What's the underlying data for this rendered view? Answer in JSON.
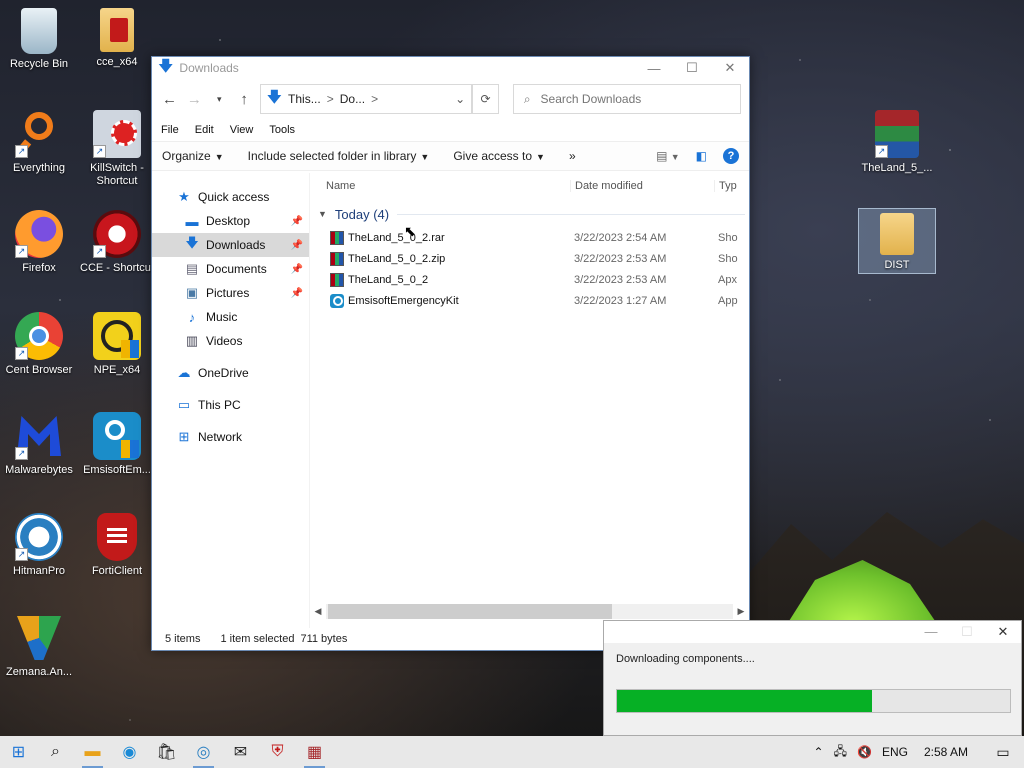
{
  "desktop": {
    "icons_left": [
      {
        "label": "Recycle Bin",
        "icon": "recycle-bin-icon"
      },
      {
        "label": "Everything",
        "icon": "everything-search-icon"
      },
      {
        "label": "Firefox",
        "icon": "firefox-icon"
      },
      {
        "label": "Cent Browser",
        "icon": "cent-browser-icon"
      },
      {
        "label": "Malwarebytes",
        "icon": "malwarebytes-icon"
      },
      {
        "label": "HitmanPro",
        "icon": "hitmanpro-icon"
      },
      {
        "label": "Zemana.An...",
        "icon": "zemana-icon"
      }
    ],
    "icons_col2": [
      {
        "label": "cce_x64",
        "icon": "cce-folder-icon"
      },
      {
        "label": "KillSwitch - Shortcut",
        "icon": "killswitch-icon"
      },
      {
        "label": "CCE - Shortcut",
        "icon": "cce-icon"
      },
      {
        "label": "NPE_x64",
        "icon": "npe-icon"
      },
      {
        "label": "EmsisoftEm...",
        "icon": "emsisoft-icon"
      },
      {
        "label": "FortiClient",
        "icon": "forticlient-icon"
      }
    ],
    "icons_right": [
      {
        "label": "TheLand_5_...",
        "icon": "winrar-archive-icon"
      },
      {
        "label": "DIST",
        "icon": "folder-icon"
      }
    ]
  },
  "explorer": {
    "title": "Downloads",
    "address": {
      "part1": "This...",
      "part2": "Do...",
      "sep": ">"
    },
    "search_placeholder": "Search Downloads",
    "menu": [
      "File",
      "Edit",
      "View",
      "Tools"
    ],
    "commands": {
      "organize": "Organize",
      "include": "Include selected folder in library",
      "share": "Give access to",
      "more": "»"
    },
    "sidebar": [
      {
        "label": "Quick access",
        "icon": "star-icon",
        "child": false,
        "pin": false
      },
      {
        "label": "Desktop",
        "icon": "desktop-icon",
        "child": true,
        "pin": true
      },
      {
        "label": "Downloads",
        "icon": "download-arrow-icon",
        "child": true,
        "pin": true,
        "active": true
      },
      {
        "label": "Documents",
        "icon": "documents-icon",
        "child": true,
        "pin": true
      },
      {
        "label": "Pictures",
        "icon": "pictures-icon",
        "child": true,
        "pin": true
      },
      {
        "label": "Music",
        "icon": "music-icon",
        "child": true,
        "pin": false
      },
      {
        "label": "Videos",
        "icon": "videos-icon",
        "child": true,
        "pin": false
      },
      {
        "label": "OneDrive",
        "icon": "onedrive-icon",
        "child": false,
        "pin": false
      },
      {
        "label": "This PC",
        "icon": "this-pc-icon",
        "child": false,
        "pin": false
      },
      {
        "label": "Network",
        "icon": "network-icon",
        "child": false,
        "pin": false
      }
    ],
    "columns": {
      "name": "Name",
      "date": "Date modified",
      "type": "Typ"
    },
    "group": "Today (4)",
    "files": [
      {
        "name": "TheLand_5_0_2.rar",
        "date": "3/22/2023 2:54 AM",
        "type": "Sho",
        "icon": "winrar-icon"
      },
      {
        "name": "TheLand_5_0_2.zip",
        "date": "3/22/2023 2:53 AM",
        "type": "Sho",
        "icon": "winrar-icon"
      },
      {
        "name": "TheLand_5_0_2",
        "date": "3/22/2023 2:53 AM",
        "type": "Apx",
        "icon": "winrar-icon"
      },
      {
        "name": "EmsisoftEmergencyKit",
        "date": "3/22/2023 1:27 AM",
        "type": "App",
        "icon": "emsisoft-icon"
      }
    ],
    "status": {
      "count": "5 items",
      "selected": "1 item selected",
      "size": "711 bytes"
    }
  },
  "download_dialog": {
    "text": "Downloading components....",
    "progress": 0.65
  },
  "taskbar": {
    "lang": "ENG",
    "time": "2:58 AM"
  },
  "colors": {
    "accent": "#1a73d6",
    "progress": "#06b025"
  }
}
